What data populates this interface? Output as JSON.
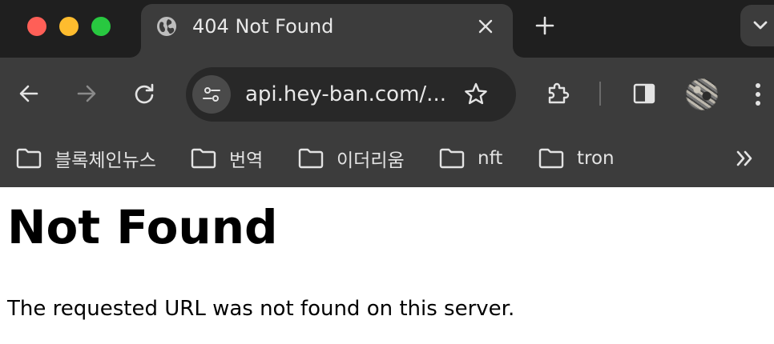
{
  "window": {
    "traffic_lights": {
      "close": "#ff5f57",
      "minimize": "#febc2e",
      "maximize": "#28c840"
    }
  },
  "tab": {
    "title": "404 Not Found",
    "favicon": "globe-icon",
    "close_icon": "close-icon"
  },
  "tabstrip": {
    "new_tab_icon": "plus-icon",
    "tab_search_icon": "chevron-down-icon"
  },
  "toolbar": {
    "back_icon": "arrow-left-icon",
    "forward_icon": "arrow-right-icon",
    "reload_icon": "reload-icon",
    "site_info_icon": "tune-icon",
    "url": "api.hey-ban.com/...",
    "bookmark_icon": "star-icon",
    "extensions_icon": "puzzle-icon",
    "side_panel_icon": "side-panel-icon",
    "menu_icon": "more-vertical-icon"
  },
  "bookmarks": {
    "items": [
      {
        "label": "블록체인뉴스",
        "icon": "folder-icon"
      },
      {
        "label": "번역",
        "icon": "folder-icon"
      },
      {
        "label": "이더리움",
        "icon": "folder-icon"
      },
      {
        "label": "nft",
        "icon": "folder-icon"
      },
      {
        "label": "tron",
        "icon": "folder-icon"
      }
    ],
    "overflow_icon": "double-chevron-right-icon"
  },
  "page": {
    "heading": "Not Found",
    "message": "The requested URL was not found on this server."
  },
  "colors": {
    "tabstrip_bg": "#1f1f1f",
    "toolbar_bg": "#3c3c3c",
    "omnibox_bg": "#282828",
    "toolbar_text": "#e8e8e8",
    "page_bg": "#ffffff",
    "page_text": "#000000"
  }
}
